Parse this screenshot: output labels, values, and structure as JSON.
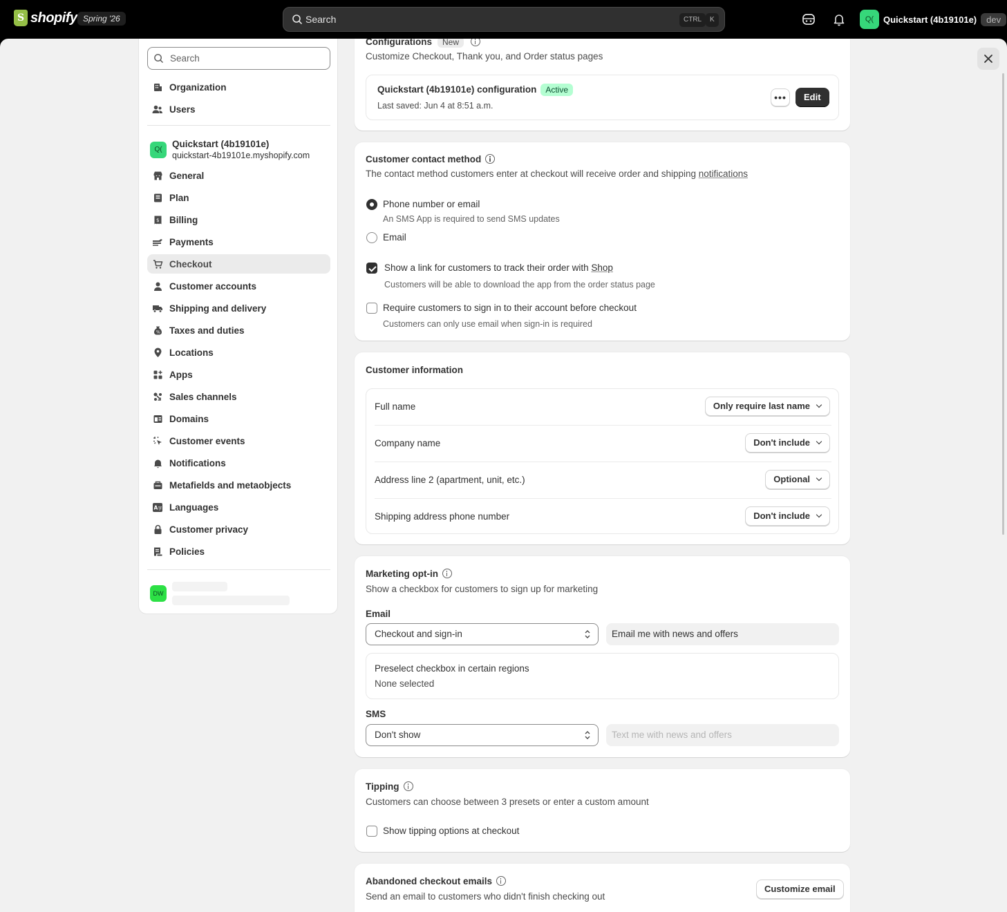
{
  "topbar": {
    "logo_text": "shopify",
    "edition": "Spring '26",
    "search_placeholder": "Search",
    "kbd_ctrl": "CTRL",
    "kbd_k": "K",
    "store_initials": "Q(",
    "store_name": "Quickstart (4b19101e)",
    "env_badge": "dev"
  },
  "sidebar": {
    "search_placeholder": "Search",
    "top_items": [
      {
        "label": "Organization",
        "icon": "building-icon"
      },
      {
        "label": "Users",
        "icon": "users-icon"
      }
    ],
    "store": {
      "initials": "Q(",
      "name": "Quickstart (4b19101e)",
      "url": "quickstart-4b19101e.myshopify.com"
    },
    "items": [
      {
        "label": "General",
        "icon": "store-icon"
      },
      {
        "label": "Plan",
        "icon": "plan-icon"
      },
      {
        "label": "Billing",
        "icon": "billing-icon"
      },
      {
        "label": "Payments",
        "icon": "payments-icon"
      },
      {
        "label": "Checkout",
        "icon": "cart-icon",
        "active": true
      },
      {
        "label": "Customer accounts",
        "icon": "person-icon"
      },
      {
        "label": "Shipping and delivery",
        "icon": "truck-icon"
      },
      {
        "label": "Taxes and duties",
        "icon": "tax-icon"
      },
      {
        "label": "Locations",
        "icon": "location-icon"
      },
      {
        "label": "Apps",
        "icon": "apps-icon"
      },
      {
        "label": "Sales channels",
        "icon": "channels-icon"
      },
      {
        "label": "Domains",
        "icon": "domains-icon"
      },
      {
        "label": "Customer events",
        "icon": "cursor-icon"
      },
      {
        "label": "Notifications",
        "icon": "bell-icon"
      },
      {
        "label": "Metafields and metaobjects",
        "icon": "metafields-icon"
      },
      {
        "label": "Languages",
        "icon": "languages-icon"
      },
      {
        "label": "Customer privacy",
        "icon": "lock-icon"
      },
      {
        "label": "Policies",
        "icon": "policies-icon"
      }
    ],
    "user_initials": "DW"
  },
  "configurations": {
    "title": "Configurations",
    "badge": "New",
    "subtitle": "Customize Checkout, Thank you, and Order status pages",
    "config_name": "Quickstart (4b19101e) configuration",
    "status": "Active",
    "last_saved": "Last saved: Jun 4 at 8:51 a.m.",
    "more_label": "•••",
    "edit_label": "Edit"
  },
  "contact": {
    "title": "Customer contact method",
    "subtitle_prefix": "The contact method customers enter at checkout will receive order and shipping ",
    "subtitle_link": "notifications",
    "opt_phone": "Phone number or email",
    "opt_phone_help": "An SMS App is required to send SMS updates",
    "opt_email": "Email",
    "shop_link_prefix": "Show a link for customers to track their order with ",
    "shop_link_word": "Shop",
    "shop_link_help": "Customers will be able to download the app from the order status page",
    "signin_label": "Require customers to sign in to their account before checkout",
    "signin_help": "Customers can only use email when sign-in is required"
  },
  "customer_info": {
    "title": "Customer information",
    "rows": [
      {
        "label": "Full name",
        "value": "Only require last name"
      },
      {
        "label": "Company name",
        "value": "Don't include"
      },
      {
        "label": "Address line 2 (apartment, unit, etc.)",
        "value": "Optional"
      },
      {
        "label": "Shipping address phone number",
        "value": "Don't include"
      }
    ]
  },
  "marketing": {
    "title": "Marketing opt-in",
    "subtitle": "Show a checkbox for customers to sign up for marketing",
    "email_label": "Email",
    "email_select": "Checkout and sign-in",
    "email_text": "Email me with news and offers",
    "preselect_title": "Preselect checkbox in certain regions",
    "preselect_value": "None selected",
    "sms_label": "SMS",
    "sms_select": "Don't show",
    "sms_text": "Text me with news and offers"
  },
  "tipping": {
    "title": "Tipping",
    "subtitle": "Customers can choose between 3 presets or enter a custom amount",
    "checkbox": "Show tipping options at checkout"
  },
  "abandoned": {
    "title": "Abandoned checkout emails",
    "subtitle": "Send an email to customers who didn't finish checking out",
    "button": "Customize email"
  }
}
